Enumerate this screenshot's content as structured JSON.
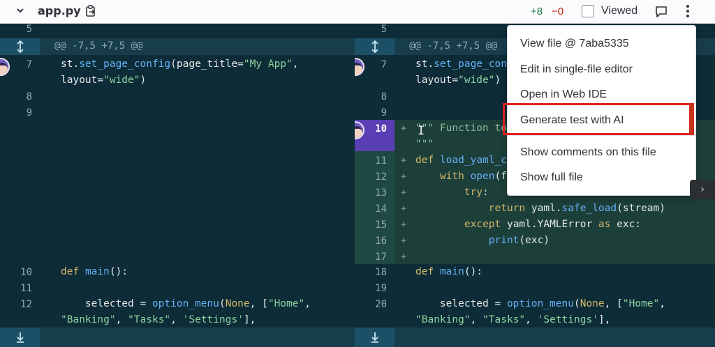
{
  "header": {
    "file_name": "app.py",
    "additions": "+8",
    "deletions": "−0",
    "viewed_label": "Viewed"
  },
  "hunk_header": "@@ -7,5 +7,5 @@",
  "left": {
    "top_line": "5",
    "lines": [
      {
        "n": "7",
        "t": "st.set_page_config(page_title=\"My App\","
      },
      {
        "n": "",
        "t": "layout=\"wide\")"
      },
      {
        "n": "8",
        "t": ""
      },
      {
        "n": "9",
        "t": ""
      },
      {
        "n": "10",
        "t": "def main():"
      },
      {
        "n": "11",
        "t": ""
      },
      {
        "n": "12",
        "t": "    selected = option_menu(None, [\"Home\","
      },
      {
        "n": "",
        "t": "\"Banking\", \"Tasks\", 'Settings'],"
      }
    ]
  },
  "right": {
    "top_line": "5",
    "lines": [
      {
        "n": "7",
        "t": "st.set_page_config(page_title=\"My App\","
      },
      {
        "n": "",
        "t": "layout=\"wide\")"
      },
      {
        "n": "8",
        "t": ""
      },
      {
        "n": "9",
        "t": ""
      },
      {
        "n": "10",
        "t": "\"\"\" Function to"
      },
      {
        "n": "",
        "t": "\"\"\""
      },
      {
        "n": "11",
        "t": "def load_yaml_c"
      },
      {
        "n": "12",
        "t": "    with open(f"
      },
      {
        "n": "13",
        "t": "        try:"
      },
      {
        "n": "14",
        "t": "            return yaml.safe_load(stream)"
      },
      {
        "n": "15",
        "t": "        except yaml.YAMLError as exc:"
      },
      {
        "n": "16",
        "t": "            print(exc)"
      },
      {
        "n": "17",
        "t": ""
      },
      {
        "n": "18",
        "t": "def main():"
      },
      {
        "n": "19",
        "t": ""
      },
      {
        "n": "20",
        "t": "    selected = option_menu(None, [\"Home\","
      },
      {
        "n": "",
        "t": "\"Banking\", \"Tasks\", 'Settings'],"
      }
    ]
  },
  "menu": {
    "items": [
      "View file @ 7aba5335",
      "Edit in single-file editor",
      "Open in Web IDE",
      "Generate test with AI",
      "Show comments on this file",
      "Show full file"
    ]
  },
  "colors": {
    "added": "#217645",
    "removed": "#c91c00",
    "highlight": "#e0201e",
    "pane": "#0d2c37"
  },
  "icons": {
    "collapse": "chevron-down-icon",
    "copy": "clipboard-icon",
    "comment": "comment-icon",
    "more": "kebab-icon",
    "expand": "expand-icon",
    "expand_down": "expand-down-icon"
  }
}
